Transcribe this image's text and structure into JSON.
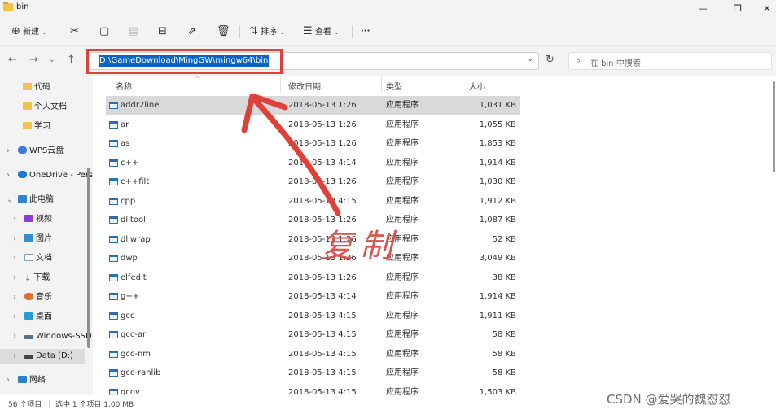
{
  "window": {
    "title": "bin"
  },
  "toolbar": {
    "new_label": "新建",
    "sort_label": "排序",
    "view_label": "查看",
    "more_label": "···"
  },
  "nav": {
    "address": "D:\\GameDownload\\MingGW\\mingw64\\bin",
    "search_placeholder": "在 bin 中搜索"
  },
  "sidebar": {
    "items": [
      {
        "label": "代码",
        "icon": "folder-icon"
      },
      {
        "label": "个人文档",
        "icon": "folder-icon"
      },
      {
        "label": "学习",
        "icon": "folder-icon"
      },
      {
        "label": "WPS云盘",
        "icon": "cloud-icon"
      },
      {
        "label": "OneDrive - Pers",
        "icon": "onedrive-icon"
      },
      {
        "label": "此电脑",
        "icon": "pc-icon"
      },
      {
        "label": "视频",
        "icon": "video-icon"
      },
      {
        "label": "图片",
        "icon": "pictures-icon"
      },
      {
        "label": "文档",
        "icon": "documents-icon"
      },
      {
        "label": "下载",
        "icon": "download-icon"
      },
      {
        "label": "音乐",
        "icon": "music-icon"
      },
      {
        "label": "桌面",
        "icon": "desktop-icon"
      },
      {
        "label": "Windows-SSD",
        "icon": "drive-icon"
      },
      {
        "label": "Data (D:)",
        "icon": "drive-icon"
      },
      {
        "label": "网络",
        "icon": "network-icon"
      }
    ]
  },
  "columns": {
    "name": "名称",
    "date": "修改日期",
    "type": "类型",
    "size": "大小"
  },
  "files": [
    {
      "name": "addr2line",
      "date": "2018-05-13 1:26",
      "type": "应用程序",
      "size": "1,031 KB"
    },
    {
      "name": "ar",
      "date": "2018-05-13 1:26",
      "type": "应用程序",
      "size": "1,055 KB"
    },
    {
      "name": "as",
      "date": "2018-05-13 1:26",
      "type": "应用程序",
      "size": "1,853 KB"
    },
    {
      "name": "c++",
      "date": "2018-05-13 4:14",
      "type": "应用程序",
      "size": "1,914 KB"
    },
    {
      "name": "c++filt",
      "date": "2018-05-13 1:26",
      "type": "应用程序",
      "size": "1,030 KB"
    },
    {
      "name": "cpp",
      "date": "2018-05-13 4:15",
      "type": "应用程序",
      "size": "1,912 KB"
    },
    {
      "name": "dlltool",
      "date": "2018-05-13 1:26",
      "type": "应用程序",
      "size": "1,087 KB"
    },
    {
      "name": "dllwrap",
      "date": "2018-05-13 1:26",
      "type": "应用程序",
      "size": "52 KB"
    },
    {
      "name": "dwp",
      "date": "2018-05-13 1:26",
      "type": "应用程序",
      "size": "3,049 KB"
    },
    {
      "name": "elfedit",
      "date": "2018-05-13 1:26",
      "type": "应用程序",
      "size": "38 KB"
    },
    {
      "name": "g++",
      "date": "2018-05-13 4:14",
      "type": "应用程序",
      "size": "1,914 KB"
    },
    {
      "name": "gcc",
      "date": "2018-05-13 4:15",
      "type": "应用程序",
      "size": "1,911 KB"
    },
    {
      "name": "gcc-ar",
      "date": "2018-05-13 4:15",
      "type": "应用程序",
      "size": "58 KB"
    },
    {
      "name": "gcc-nm",
      "date": "2018-05-13 4:15",
      "type": "应用程序",
      "size": "58 KB"
    },
    {
      "name": "gcc-ranlib",
      "date": "2018-05-13 4:15",
      "type": "应用程序",
      "size": "58 KB"
    },
    {
      "name": "gcov",
      "date": "2018-05-13 4:15",
      "type": "应用程序",
      "size": "1,503 KB"
    }
  ],
  "status": {
    "count": "56 个项目",
    "selection": "选中 1 个项目  1.00 MB"
  },
  "annotation": {
    "text": "复制",
    "color": "#e0403a"
  },
  "watermark": "CSDN @爱哭的魏怼怼"
}
